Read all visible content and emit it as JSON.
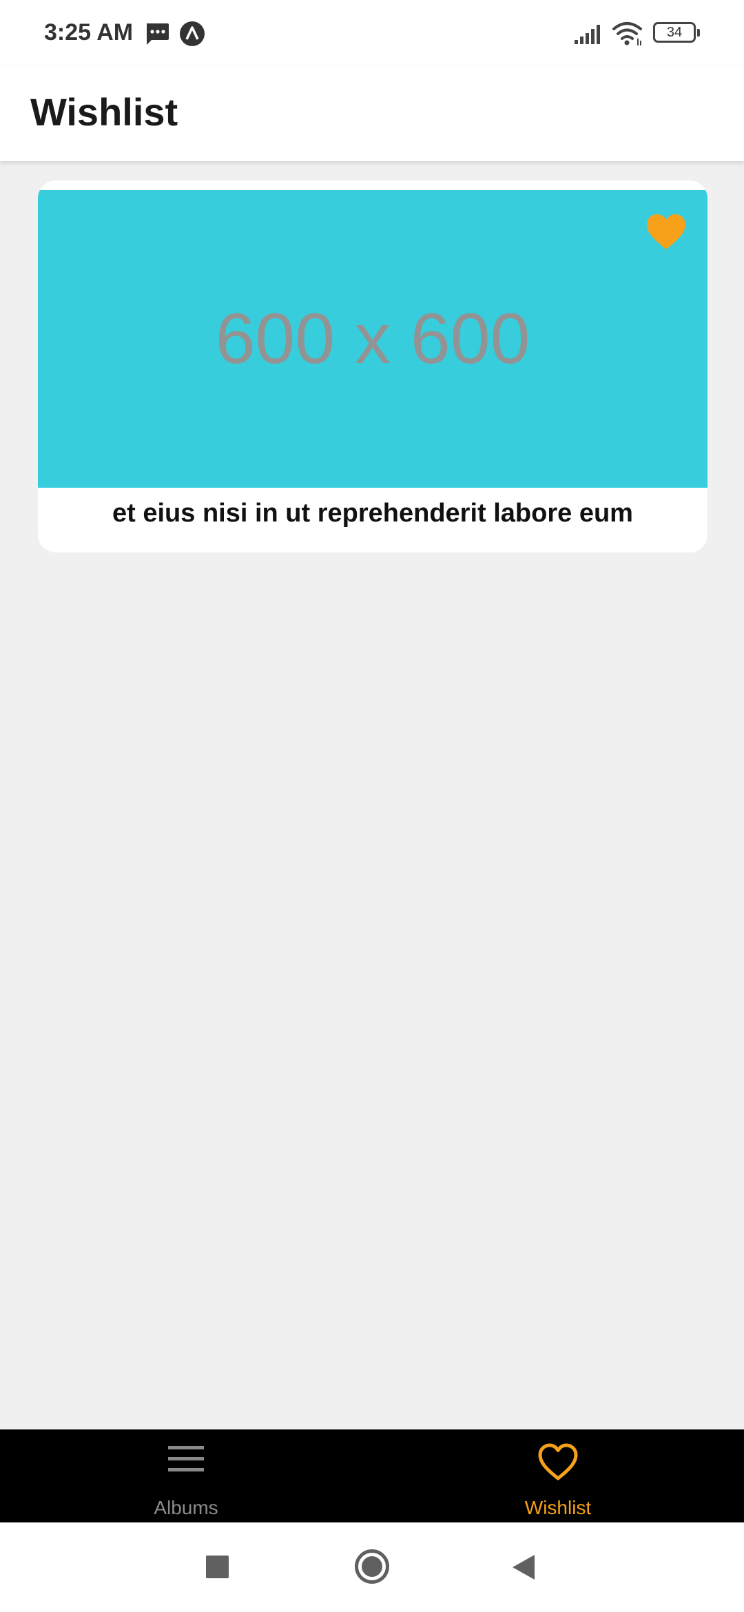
{
  "status_bar": {
    "time": "3:25 AM",
    "battery": "34",
    "icons": [
      "message-icon",
      "app-notification-icon",
      "signal-icon",
      "wifi-icon",
      "battery-icon"
    ]
  },
  "header": {
    "title": "Wishlist"
  },
  "wishlist": {
    "items": [
      {
        "image_text": "600 x 600",
        "image_color": "#37cddc",
        "title": "et eius nisi in ut reprehenderit labore eum",
        "favorite_icon": "heart-filled-icon"
      }
    ]
  },
  "tabs": [
    {
      "label": "Albums",
      "icon": "menu-icon",
      "active": false
    },
    {
      "label": "Wishlist",
      "icon": "heart-outline-icon",
      "active": true
    }
  ],
  "colors": {
    "accent": "#f7a01a",
    "inactive_tab": "#8a8a8a",
    "tab_bar_background": "#000000",
    "page_background": "#f0f0f0"
  }
}
